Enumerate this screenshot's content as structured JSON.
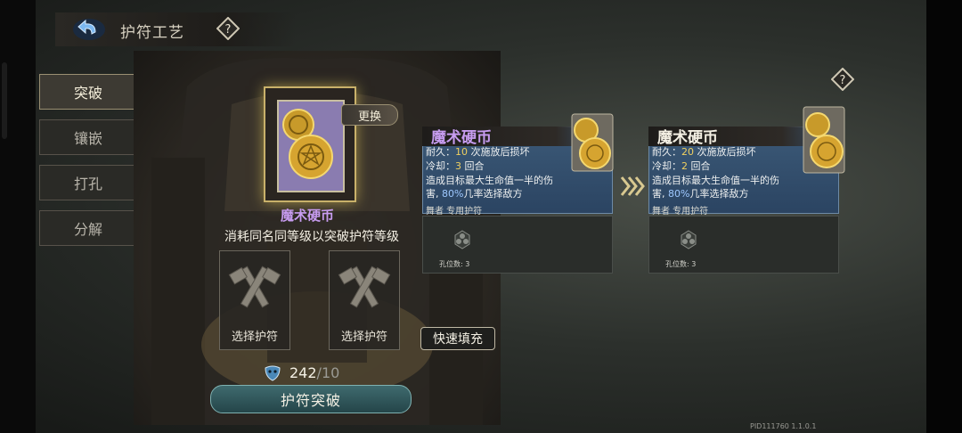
{
  "header": {
    "title": "护符工艺",
    "help_glyph": "?"
  },
  "menu": [
    {
      "label": "突破",
      "active": true
    },
    {
      "label": "镶嵌",
      "active": false
    },
    {
      "label": "打孔",
      "active": false
    },
    {
      "label": "分解",
      "active": false
    }
  ],
  "main": {
    "card_name": "魔术硬币",
    "swap_label": "更换",
    "description": "消耗同名同等级以突破护符等级",
    "slots": [
      {
        "label": "选择护符"
      },
      {
        "label": "选择护符"
      }
    ],
    "quick_fill_label": "快速填充",
    "material_count": "242",
    "material_sep": "/",
    "material_required": "10",
    "breakthrough_label": "护符突破"
  },
  "panels": [
    {
      "title": "魔术硬币",
      "title_color": "#c79cf0",
      "durability_prefix": "耐久：",
      "durability_value": "10",
      "durability_suffix": " 次施放后损坏",
      "cooldown_prefix": "冷却：",
      "cooldown_value": "3",
      "cooldown_suffix": " 回合",
      "effect_line1": "造成目标最大生命值一半的伤",
      "effect_line2_prefix": "害, ",
      "effect_percent": "80%",
      "effect_line2_suffix": "几率选择敌方",
      "role": "舞者 专用护符",
      "hole_label": "孔位数: 3"
    },
    {
      "title": "魔术硬币",
      "title_color": "#f4f0e4",
      "durability_prefix": "耐久：",
      "durability_value": "20",
      "durability_suffix": " 次施放后损坏",
      "cooldown_prefix": "冷却：",
      "cooldown_value": "2",
      "cooldown_suffix": " 回合",
      "effect_line1": "造成目标最大生命值一半的伤",
      "effect_line2_prefix": "害, ",
      "effect_percent": "80%",
      "effect_line2_suffix": "几率选择敌方",
      "role": "舞者 专用护符",
      "hole_label": "孔位数: 3"
    }
  ],
  "footer": {
    "pid": "PID111760  1.1.0.1"
  },
  "colors": {
    "accent_gold": "#c9b16a",
    "panel_blue": "#3c5a78",
    "break_teal": "#3f6a6e"
  }
}
